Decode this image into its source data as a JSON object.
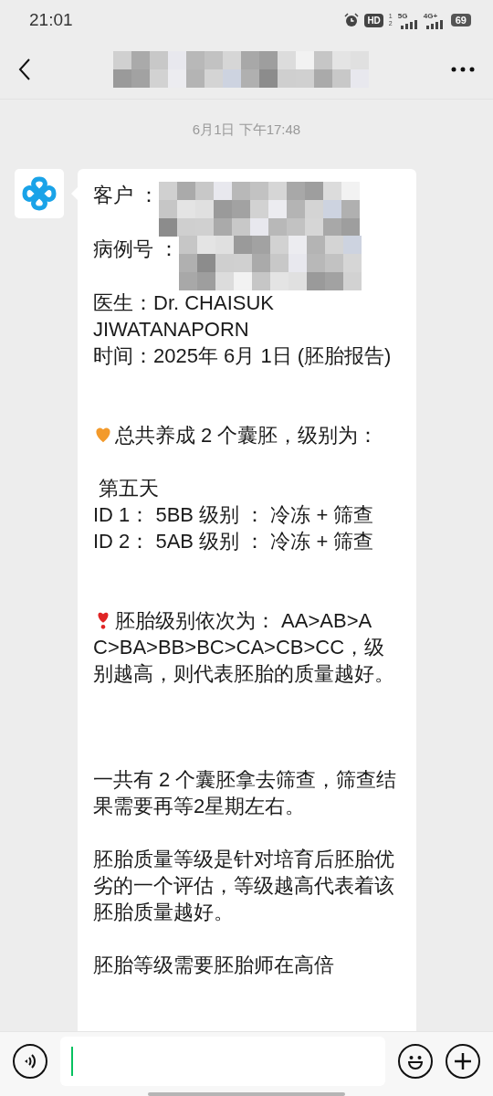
{
  "status_bar": {
    "time": "21:01",
    "hd": "HD",
    "sim_marks": [
      "1",
      "2"
    ],
    "net1": "5G",
    "net2": "4G+",
    "battery": "69"
  },
  "header": {
    "title_redacted": true
  },
  "timestamp": "6月1日 下午17:48",
  "message": {
    "paragraphs": [
      {
        "kind": "field",
        "label": "客户 ：",
        "redacted": true
      },
      {
        "kind": "field",
        "label": "病例号 ：",
        "redacted": true
      },
      {
        "kind": "text",
        "text": "医生：Dr. CHAISUK JIWATANAPORN"
      },
      {
        "kind": "text",
        "text": "时间：2025年 6月 1日 (胚胎报告)"
      },
      {
        "kind": "gap"
      },
      {
        "kind": "gap"
      },
      {
        "kind": "heart",
        "text": "总共养成 2 个囊胚，级别为："
      },
      {
        "kind": "gap"
      },
      {
        "kind": "text",
        "text": " 第五天"
      },
      {
        "kind": "text",
        "text": "ID 1： 5BB 级别 ： 冷冻 + 筛查"
      },
      {
        "kind": "text",
        "text": "ID 2： 5AB 级别 ： 冷冻 + 筛查"
      },
      {
        "kind": "gap"
      },
      {
        "kind": "gap"
      },
      {
        "kind": "alert",
        "text": "胚胎级别依次为： AA>AB>A",
        "continued": "C>BA>BB>BC>CA>CB>CC，级别越高，则代表胚胎的质量越好。"
      },
      {
        "kind": "gap"
      },
      {
        "kind": "gap"
      },
      {
        "kind": "gap"
      },
      {
        "kind": "text",
        "text": "一共有 2 个囊胚拿去筛查，筛查结果需要再等2星期左右。"
      },
      {
        "kind": "gap"
      },
      {
        "kind": "text",
        "text": "胚胎质量等级是针对培育后胚胎优劣的一个评估，等级越高代表着该胚胎质量越好。"
      },
      {
        "kind": "gap"
      },
      {
        "kind": "text",
        "text": "胚胎等级需要胚胎师在高倍"
      }
    ]
  }
}
